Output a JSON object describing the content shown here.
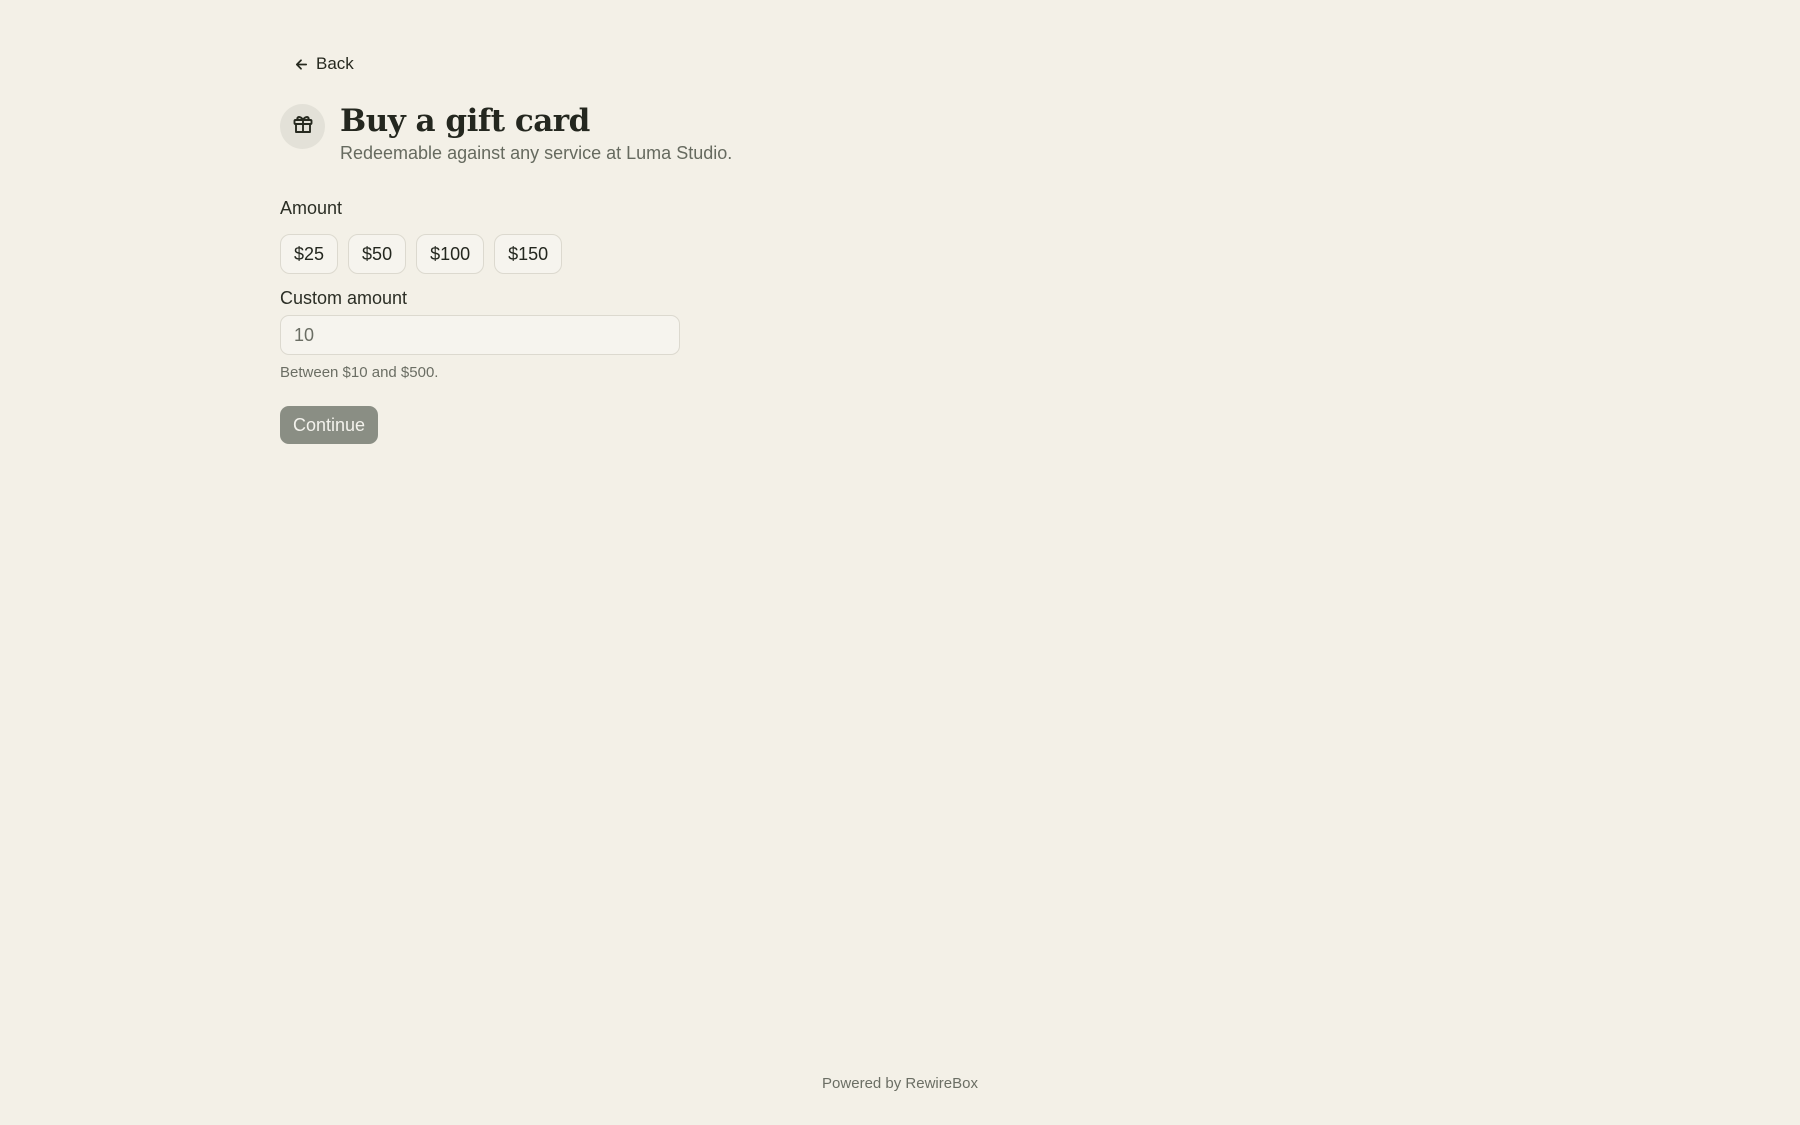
{
  "nav": {
    "back_label": "Back"
  },
  "header": {
    "icon": "gift-icon",
    "title": "Buy a gift card",
    "subtitle": "Redeemable against any service at Luma Studio."
  },
  "amount": {
    "label": "Amount",
    "options": [
      "$25",
      "$50",
      "$100",
      "$150"
    ]
  },
  "custom_amount": {
    "label": "Custom amount",
    "value": "10",
    "hint": "Between $10 and $500."
  },
  "actions": {
    "continue_label": "Continue"
  },
  "footer": {
    "text": "Powered by RewireBox"
  },
  "colors": {
    "background": "#f3f0e7",
    "button_disabled": "#8a8e84",
    "text_primary": "#24271f",
    "text_muted": "#6b6e64"
  }
}
